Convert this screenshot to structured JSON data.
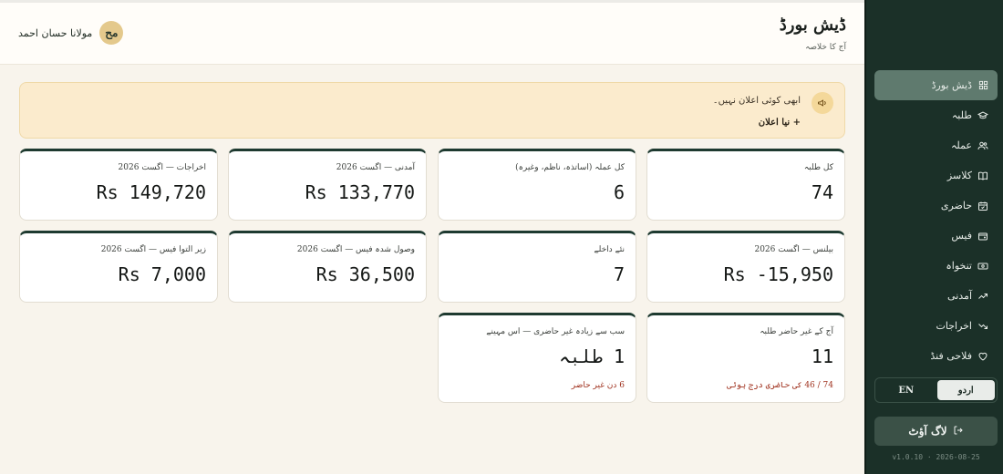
{
  "header": {
    "title": "ڈیش بورڈ",
    "subtitle": "آج کا خلاصہ",
    "user_name": "مولانا حسان احمد",
    "avatar_initials": "مح"
  },
  "notice": {
    "text": "ابھی کوئی اعلان نہیں۔",
    "link": "+ نیا اعلان",
    "icon": "megaphone-icon"
  },
  "cards": [
    {
      "label": "کل طلبہ",
      "value": "74"
    },
    {
      "label": "کل عملہ (اساتذہ، ناظم، وغیرہ)",
      "value": "6"
    },
    {
      "label": "آمدنی — اگست 2026",
      "value": "Rs 133,770"
    },
    {
      "label": "اخراجات — اگست 2026",
      "value": "Rs 149,720"
    },
    {
      "label": "بیلنس — اگست 2026",
      "value": "Rs -15,950"
    },
    {
      "label": "نئے داخلے",
      "value": "7"
    },
    {
      "label": "وصول شدہ فیس — اگست 2026",
      "value": "Rs 36,500"
    },
    {
      "label": "زیر التوا فیس — اگست 2026",
      "value": "Rs 7,000"
    },
    {
      "label": "آج کے غیر حاضر طلبہ",
      "value": "11",
      "note": "74 / 46 کی حاضری درج ہوئی"
    },
    {
      "label": "سب سے زیادہ غیر حاضری — اس مہینے",
      "value": "1 طلبہ",
      "note": "6 دن غیر حاضر"
    }
  ],
  "sidebar": {
    "items": [
      {
        "label": "ڈیش بورڈ",
        "icon": "grid-icon",
        "active": true
      },
      {
        "label": "طلبہ",
        "icon": "graduation-cap-icon"
      },
      {
        "label": "عملہ",
        "icon": "users-icon"
      },
      {
        "label": "کلاسز",
        "icon": "book-icon"
      },
      {
        "label": "حاضری",
        "icon": "calendar-check-icon"
      },
      {
        "label": "فیس",
        "icon": "wallet-icon"
      },
      {
        "label": "تنخواہ",
        "icon": "cash-icon"
      },
      {
        "label": "آمدنی",
        "icon": "trending-up-icon"
      },
      {
        "label": "اخراجات",
        "icon": "trending-down-icon"
      },
      {
        "label": "فلاحی فنڈ",
        "icon": "heart-icon"
      }
    ],
    "lang_en": "EN",
    "lang_ur": "اردو",
    "logout": "لاگ آؤٹ",
    "version": "v1.0.10 · 2026-08-25"
  },
  "colors": {
    "sidebar_bg": "#1b3028",
    "accent": "#1e3a30",
    "notice_bg": "#fbebcd",
    "danger": "#a0321f",
    "avatar": "#e4c98c"
  }
}
